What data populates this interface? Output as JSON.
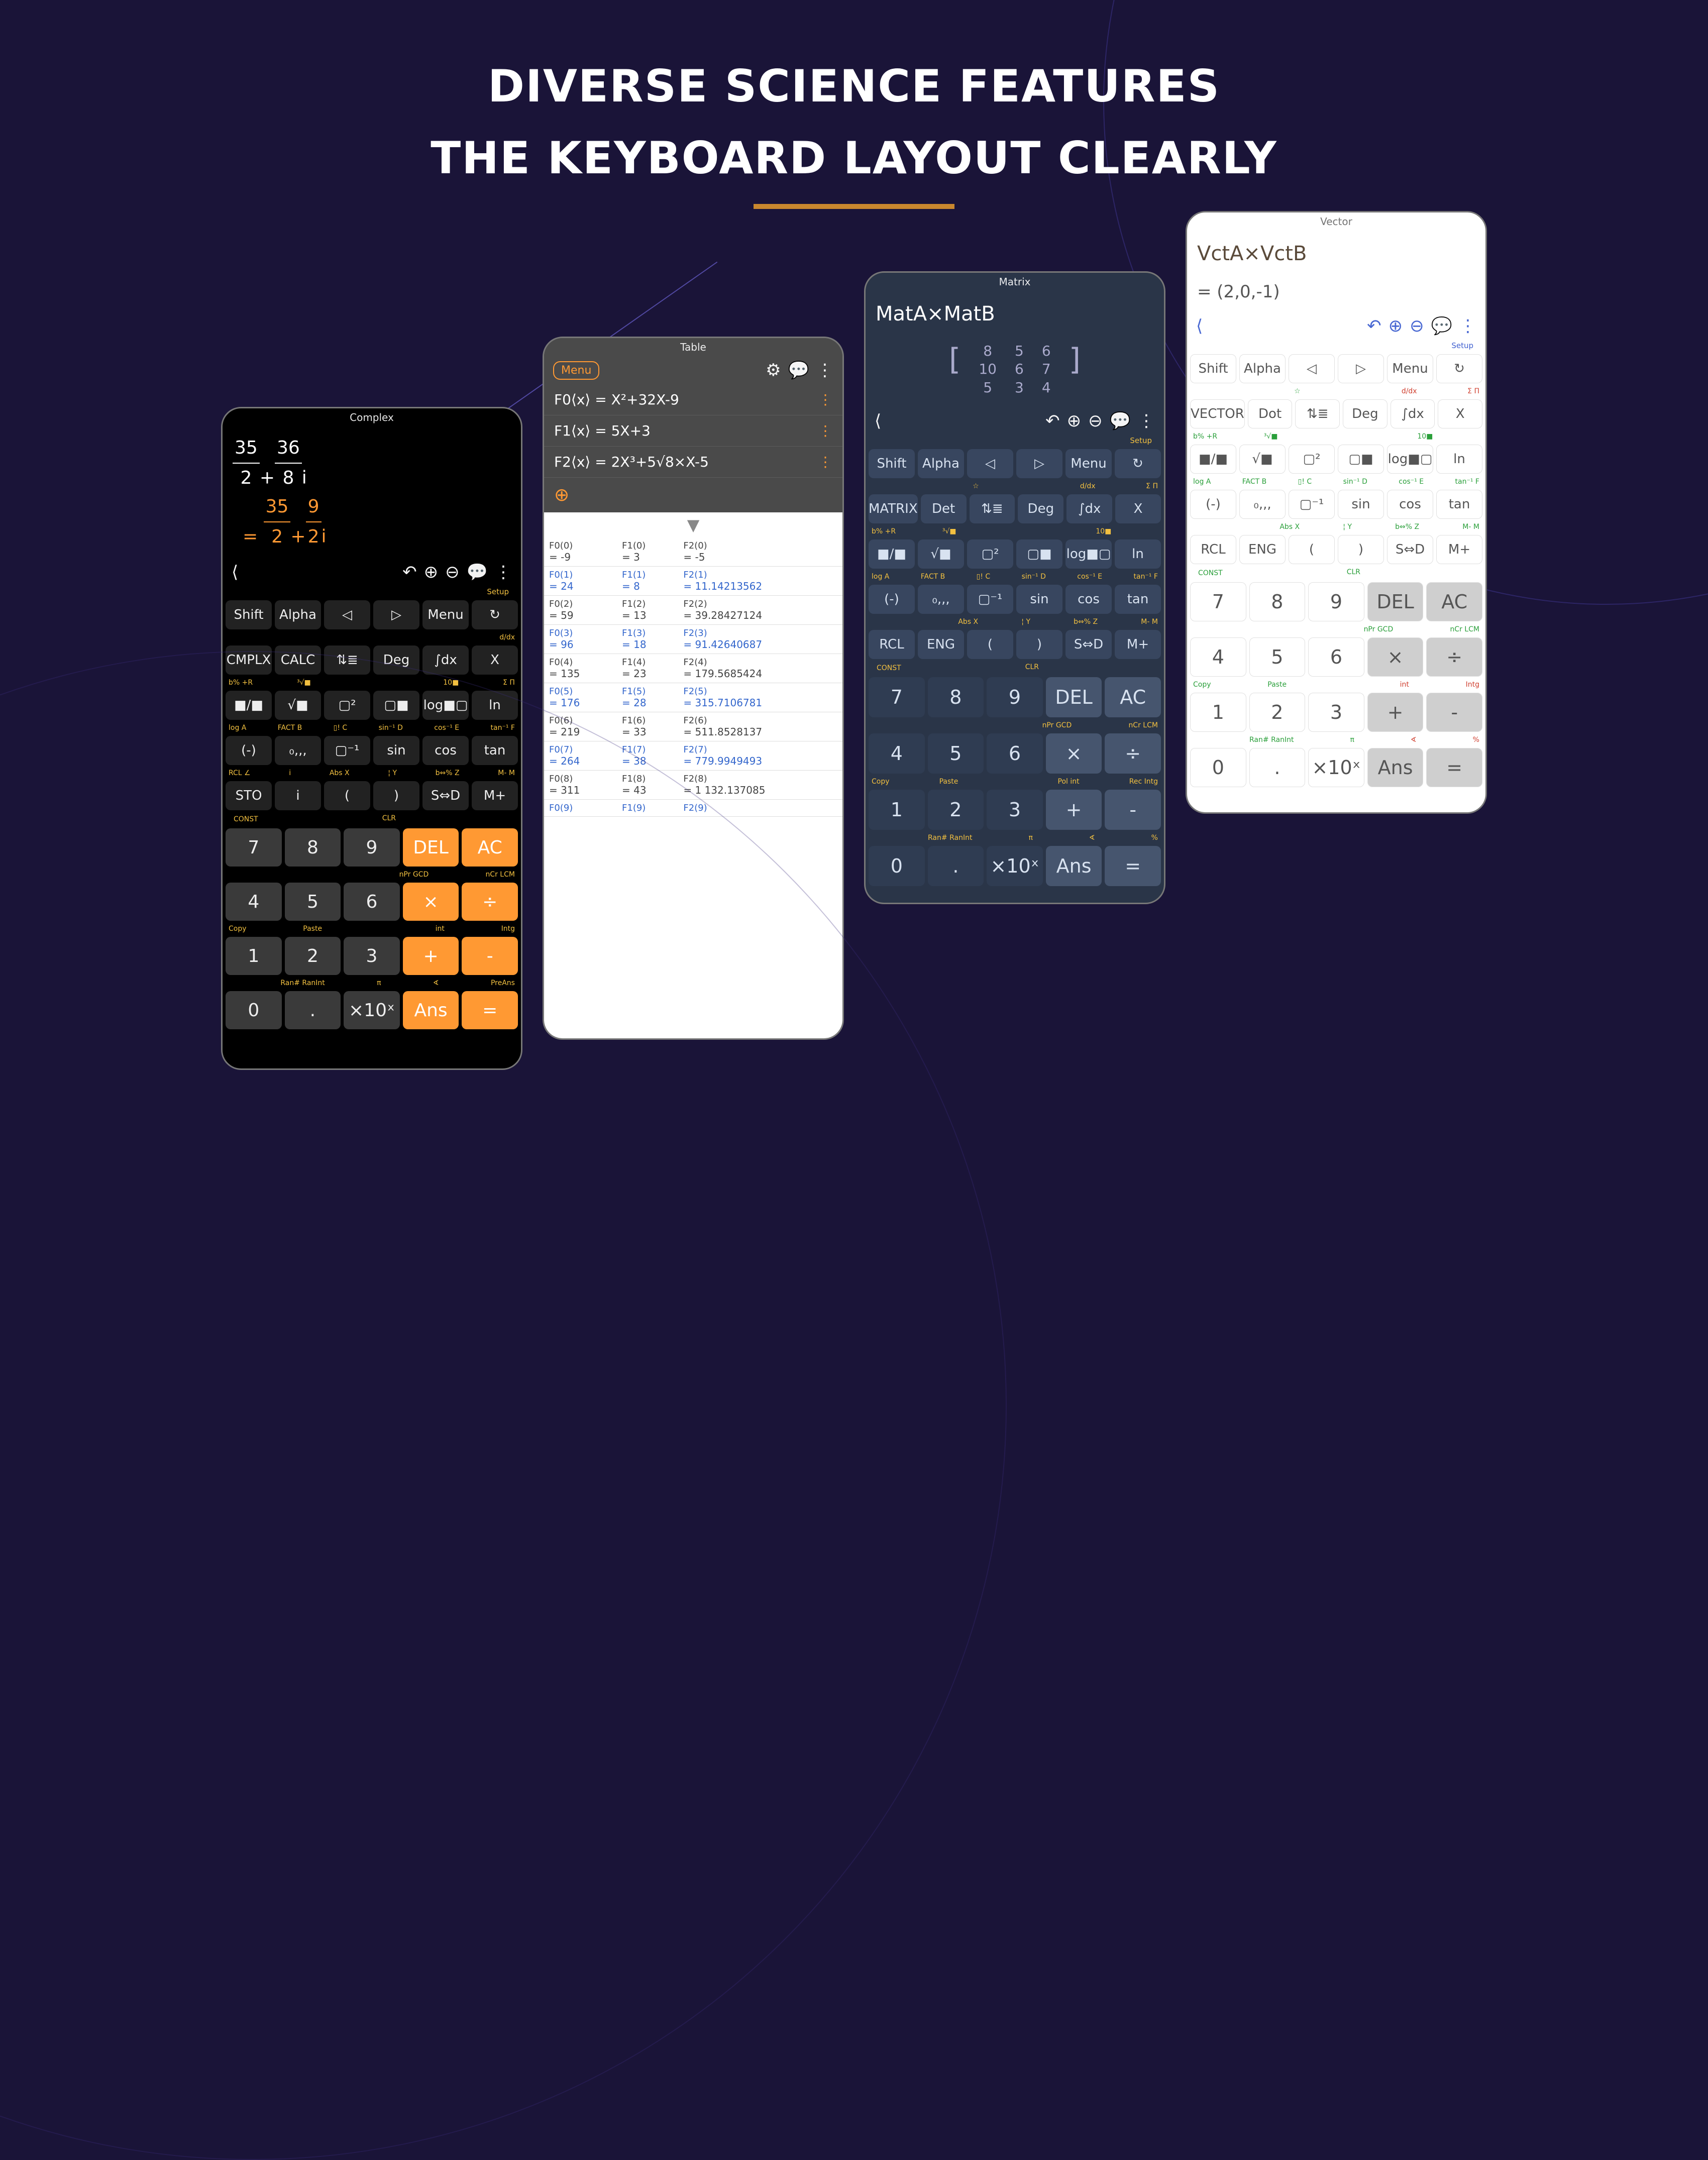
{
  "headline": {
    "line1": "DIVERSE SCIENCE FEATURES",
    "line2": "THE KEYBOARD LAYOUT CLEARLY"
  },
  "labels": {
    "setup": "Setup",
    "const": "CONST",
    "clr": "CLR"
  },
  "hints": {
    "ddx": {
      "r": "d/dx"
    },
    "row2": {
      "l": "b%   +R",
      "l2": "³√■",
      "l3": "",
      "l4": "",
      "l5": "10■",
      "r": "Σ    Π"
    },
    "row3": {
      "l": "log  A",
      "l2": "FACT B",
      "l3": "▯! C",
      "l4": "sin⁻¹ D",
      "l5": "cos⁻¹ E",
      "l6": "tan⁻¹ F"
    },
    "row4": {
      "l": "RCL  ∠",
      "l2": "i",
      "l3": "Abs  X",
      "l4": "¦   Y",
      "l5": "b⇔% Z",
      "l6": "M-  M"
    },
    "num1": {
      "l4": "nPr  GCD",
      "l5": "nCr  LCM"
    },
    "num2": {
      "l1": "Copy",
      "l2": "Paste",
      "l4": "int",
      "l5": "Intg"
    },
    "num2b": {
      "l1": "Copy",
      "l2": "Paste",
      "l3": "",
      "l4": "Pol  int",
      "l5": "Rec  Intg"
    },
    "num3": {
      "l2": "Ran# RanInt",
      "l3": "π",
      "l4": "∢",
      "l5": "PreAns"
    },
    "num3b": {
      "l2": "Ran# RanInt",
      "l3": "π",
      "l4": "∢",
      "l5": "%"
    }
  },
  "p1": {
    "title": "Complex",
    "expr": "35/2 + 36/8 i",
    "result": "= 35/2 + 9/2 i",
    "secRow1": [
      "Shift",
      "Alpha",
      "◁",
      "▷",
      "Menu",
      "↻"
    ],
    "secRow2": [
      "CMPLX",
      "CALC",
      "⇅≣",
      "Deg",
      "∫dx",
      "X"
    ],
    "secRow3": [
      "■/■",
      "√■",
      "▢²",
      "▢■",
      "log■▢",
      "ln"
    ],
    "secRow4": [
      "(-)",
      "₀,,,",
      "▢⁻¹",
      "sin",
      "cos",
      "tan"
    ],
    "secRow5": [
      "STO",
      "i",
      "(",
      ")",
      "S⇔D",
      "M+"
    ],
    "num": [
      [
        "7",
        "8",
        "9",
        "DEL",
        "AC"
      ],
      [
        "4",
        "5",
        "6",
        "×",
        "÷"
      ],
      [
        "1",
        "2",
        "3",
        "+",
        "-"
      ],
      [
        "0",
        ".",
        "×10ˣ",
        "Ans",
        "="
      ]
    ]
  },
  "p2": {
    "title": "Table",
    "menu": "Menu",
    "eqs": [
      "F0⟨x⟩ = X²+32X-9",
      "F1⟨x⟩ = 5X+3",
      "F2⟨x⟩ = 2X³+5√8×X-5"
    ],
    "plus": "⊕",
    "tri": "▼",
    "rows": [
      {
        "f0l": "F0(0)",
        "f0v": "= -9",
        "f1l": "F1(0)",
        "f1v": "= 3",
        "f2l": "F2(0)",
        "f2v": "= -5",
        "b": false
      },
      {
        "f0l": "F0(1)",
        "f0v": "= 24",
        "f1l": "F1(1)",
        "f1v": "= 8",
        "f2l": "F2(1)",
        "f2v": "= 11.14213562",
        "b": true
      },
      {
        "f0l": "F0(2)",
        "f0v": "= 59",
        "f1l": "F1(2)",
        "f1v": "= 13",
        "f2l": "F2(2)",
        "f2v": "= 39.28427124",
        "b": false
      },
      {
        "f0l": "F0(3)",
        "f0v": "= 96",
        "f1l": "F1(3)",
        "f1v": "= 18",
        "f2l": "F2(3)",
        "f2v": "= 91.42640687",
        "b": true
      },
      {
        "f0l": "F0(4)",
        "f0v": "= 135",
        "f1l": "F1(4)",
        "f1v": "= 23",
        "f2l": "F2(4)",
        "f2v": "= 179.5685424",
        "b": false
      },
      {
        "f0l": "F0(5)",
        "f0v": "= 176",
        "f1l": "F1(5)",
        "f1v": "= 28",
        "f2l": "F2(5)",
        "f2v": "= 315.7106781",
        "b": true
      },
      {
        "f0l": "F0(6)",
        "f0v": "= 219",
        "f1l": "F1(6)",
        "f1v": "= 33",
        "f2l": "F2(6)",
        "f2v": "= 511.8528137",
        "b": false
      },
      {
        "f0l": "F0(7)",
        "f0v": "= 264",
        "f1l": "F1(7)",
        "f1v": "= 38",
        "f2l": "F2(7)",
        "f2v": "= 779.9949493",
        "b": true
      },
      {
        "f0l": "F0(8)",
        "f0v": "= 311",
        "f1l": "F1(8)",
        "f1v": "= 43",
        "f2l": "F2(8)",
        "f2v": "= 1 132.137085",
        "b": false
      },
      {
        "f0l": "F0(9)",
        "f0v": "",
        "f1l": "F1(9)",
        "f1v": "",
        "f2l": "F2(9)",
        "f2v": "",
        "b": true
      }
    ]
  },
  "p3": {
    "title": "Matrix",
    "expr": "MatA×MatB",
    "mat": [
      [
        "8",
        "5",
        "6"
      ],
      [
        "10",
        "6",
        "7"
      ],
      [
        "5",
        "3",
        "4"
      ]
    ],
    "secRow1": [
      "Shift",
      "Alpha",
      "◁",
      "▷",
      "Menu",
      "↻"
    ],
    "secRow2": [
      "MATRIX",
      "Det",
      "⇅≣",
      "Deg",
      "∫dx",
      "X"
    ],
    "secRow3": [
      "■/■",
      "√■",
      "▢²",
      "▢■",
      "log■▢",
      "ln"
    ],
    "secRow4": [
      "(-)",
      "₀,,,",
      "▢⁻¹",
      "sin",
      "cos",
      "tan"
    ],
    "secRow5": [
      "RCL",
      "ENG",
      "(",
      ")",
      "S⇔D",
      "M+"
    ],
    "num": [
      [
        "7",
        "8",
        "9",
        "DEL",
        "AC"
      ],
      [
        "4",
        "5",
        "6",
        "×",
        "÷"
      ],
      [
        "1",
        "2",
        "3",
        "+",
        "-"
      ],
      [
        "0",
        ".",
        "×10ˣ",
        "Ans",
        "="
      ]
    ]
  },
  "p4": {
    "title": "Vector",
    "expr": "VctA×VctB",
    "result": "= (2,0,-1)",
    "secRow1": [
      "Shift",
      "Alpha",
      "◁",
      "▷",
      "Menu",
      "↻"
    ],
    "secRow2": [
      "VECTOR",
      "Dot",
      "⇅≣",
      "Deg",
      "∫dx",
      "X"
    ],
    "secRow3": [
      "■/■",
      "√■",
      "▢²",
      "▢■",
      "log■▢",
      "ln"
    ],
    "secRow4": [
      "(-)",
      "₀,,,",
      "▢⁻¹",
      "sin",
      "cos",
      "tan"
    ],
    "secRow5": [
      "RCL",
      "ENG",
      "(",
      ")",
      "S⇔D",
      "M+"
    ],
    "num": [
      [
        "7",
        "8",
        "9",
        "DEL",
        "AC"
      ],
      [
        "4",
        "5",
        "6",
        "×",
        "÷"
      ],
      [
        "1",
        "2",
        "3",
        "+",
        "-"
      ],
      [
        "0",
        ".",
        "×10ˣ",
        "Ans",
        "="
      ]
    ]
  }
}
